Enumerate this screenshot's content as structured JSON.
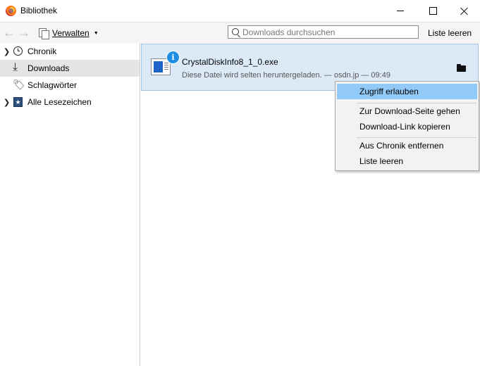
{
  "window": {
    "title": "Bibliothek"
  },
  "toolbar": {
    "organize_label": "Verwalten",
    "search_placeholder": "Downloads durchsuchen",
    "search_value": "",
    "clear_label": "Liste leeren"
  },
  "sidebar": {
    "items": [
      {
        "label": "Chronik",
        "icon": "clock-icon",
        "expandable": true
      },
      {
        "label": "Downloads",
        "icon": "download-icon",
        "selected": true
      },
      {
        "label": "Schlagwörter",
        "icon": "tag-icon"
      },
      {
        "label": "Alle Lesezeichen",
        "icon": "bookmarks-star-icon",
        "expandable": true
      }
    ]
  },
  "download": {
    "filename": "CrystalDiskInfo8_1_0.exe",
    "status": "Diese Datei wird selten heruntergeladen. — osdn.jp — 09:49"
  },
  "context_menu": {
    "items": [
      {
        "label": "Zugriff erlauben",
        "highlighted": true
      },
      {
        "label": "Zur Download-Seite gehen"
      },
      {
        "label": "Download-Link kopieren"
      },
      {
        "label": "Aus Chronik entfernen"
      },
      {
        "label": "Liste leeren"
      }
    ]
  },
  "colors": {
    "selection_highlight": "#91c9f7",
    "download_item_bg": "#dceaf8",
    "info_badge": "#1e8ee5"
  }
}
